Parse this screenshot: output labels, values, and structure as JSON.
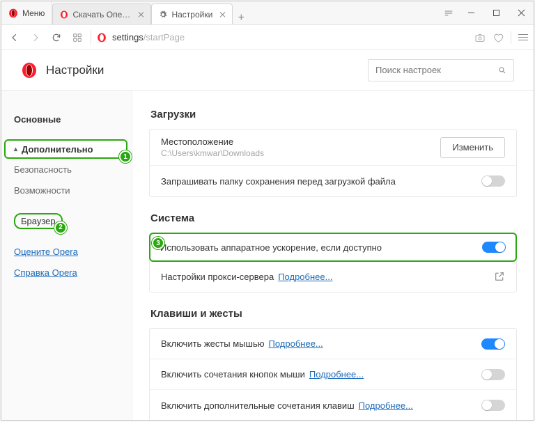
{
  "titlebar": {
    "menu_label": "Меню",
    "tabs": [
      {
        "label": "Скачать Опера для комп"
      },
      {
        "label": "Настройки"
      }
    ]
  },
  "addressbar": {
    "host": "settings",
    "path": "/startPage"
  },
  "settings_header": {
    "title": "Настройки",
    "search_placeholder": "Поиск настроек"
  },
  "sidebar": {
    "items": {
      "basic": "Основные",
      "advanced": "Дополнительно",
      "security": "Безопасность",
      "features": "Возможности",
      "browser": "Браузер",
      "rate": "Оцените Opera",
      "help": "Справка Opera"
    },
    "badges": {
      "advanced": "1",
      "browser": "2",
      "hw": "3"
    }
  },
  "content": {
    "downloads": {
      "title": "Загрузки",
      "location_label": "Местоположение",
      "location_value": "C:\\Users\\kmwar\\Downloads",
      "change_btn": "Изменить",
      "ask_label": "Запрашивать папку сохранения перед загрузкой файла"
    },
    "system": {
      "title": "Система",
      "hw_label": "Использовать аппаратное ускорение, если доступно",
      "proxy_label": "Настройки прокси-сервера",
      "more": "Подробнее..."
    },
    "gestures": {
      "title": "Клавиши и жесты",
      "mouse_label": "Включить жесты мышью",
      "rocker_label": "Включить сочетания кнопок мыши",
      "extra_label": "Включить дополнительные сочетания клавиш",
      "more": "Подробнее..."
    }
  }
}
